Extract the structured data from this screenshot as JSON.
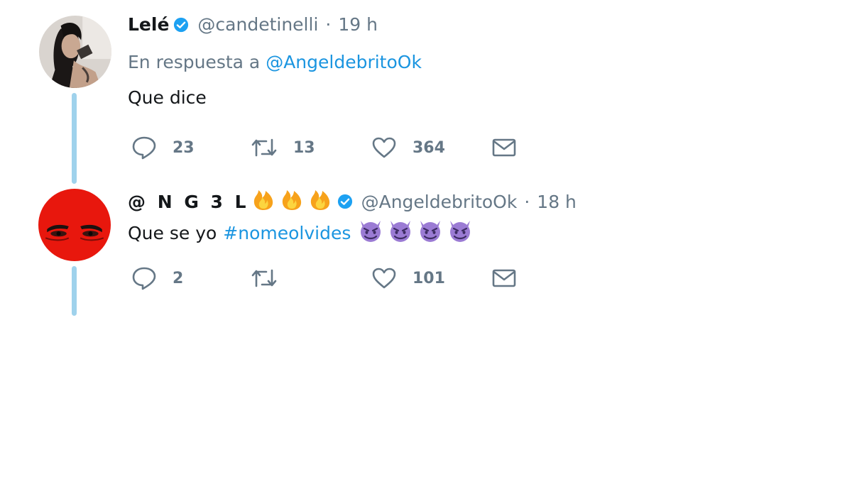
{
  "tweets": [
    {
      "name": "Lelé",
      "verified": true,
      "handle": "@candetinelli",
      "separator": "·",
      "time": "19 h",
      "reply_prefix": "En respuesta a",
      "reply_handle": "@AngeldebritoOk",
      "text": "Que dice",
      "stats": {
        "replies": "23",
        "retweets": "13",
        "likes": "364"
      }
    },
    {
      "name": "@ N G 3 L",
      "name_emojis": [
        "fire-emoji",
        "fire-emoji",
        "fire-emoji"
      ],
      "verified": true,
      "handle": "@AngeldebritoOk",
      "separator": "·",
      "time": "18 h",
      "text": "Que se yo",
      "hashtag": "#nomeolvides",
      "text_emojis": [
        "smiling-imp-emoji",
        "smiling-imp-emoji",
        "smiling-imp-emoji",
        "smiling-imp-emoji"
      ],
      "stats": {
        "replies": "2",
        "retweets": "",
        "likes": "101"
      }
    }
  ],
  "icons": {
    "reply": "speech-bubble-icon",
    "retweet": "retweet-icon",
    "like": "heart-icon",
    "dm": "envelope-icon",
    "verified": "verified-badge-icon"
  },
  "colors": {
    "link": "#1b95e0",
    "muted": "#657786",
    "thread_line": "#9fd2ec",
    "verified": "#1da1f2",
    "avatar_2_bg": "#e8170d",
    "imp_emoji": "#9b7bd4"
  }
}
